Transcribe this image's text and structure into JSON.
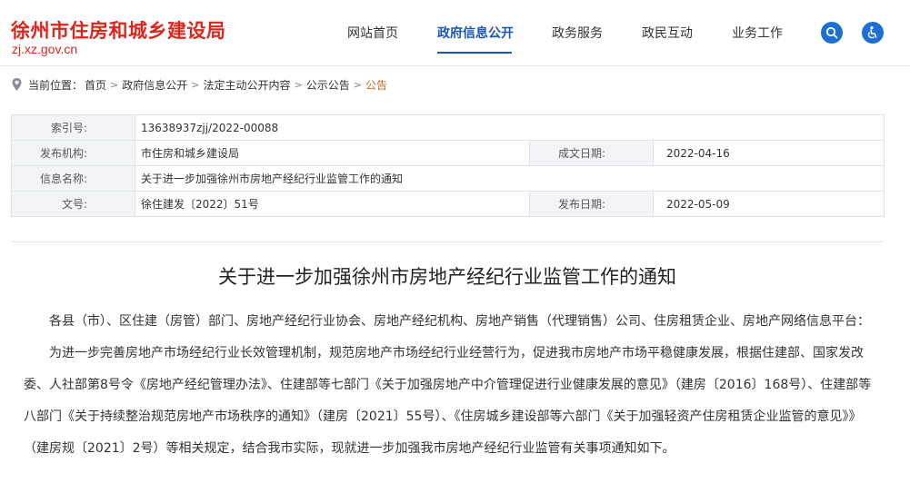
{
  "brand": {
    "title": "徐州市住房和城乡建设局",
    "domain": "zj.xz.gov.cn"
  },
  "nav": {
    "items": [
      {
        "label": "网站首页"
      },
      {
        "label": "政府信息公开"
      },
      {
        "label": "政务服务"
      },
      {
        "label": "政民互动"
      },
      {
        "label": "业务工作"
      }
    ],
    "active_index": 1
  },
  "colors": {
    "brand_red": "#d9271d",
    "nav_blue": "#1a55b8",
    "icon_blue": "#1e6fd2",
    "crumb_last": "#c06a2b"
  },
  "icons": {
    "search": "search-icon",
    "accessibility": "accessibility-icon",
    "location": "location-pin-icon"
  },
  "breadcrumb": {
    "prefix": "当前位置：",
    "items": [
      "首页",
      "政府信息公开",
      "法定主动公开内容",
      "公示公告",
      "公告"
    ],
    "separator": ">"
  },
  "meta": {
    "index_no_label": "索引号:",
    "index_no": "13638937zjj/2022-00088",
    "publisher_label": "发布机构:",
    "publisher": "市住房和城乡建设局",
    "created_label": "成文日期:",
    "created": "2022-04-16",
    "info_name_label": "信息名称:",
    "info_name": "关于进一步加强徐州市房地产经纪行业监管工作的通知",
    "doc_no_label": "文号:",
    "doc_no": "徐住建发〔2022〕51号",
    "published_label": "发布日期:",
    "published": "2022-05-09"
  },
  "article": {
    "title": "关于进一步加强徐州市房地产经纪行业监管工作的通知",
    "salutation": "各县（市）、区住建（房管）部门、房地产经纪行业协会、房地产经纪机构、房地产销售（代理销售）公司、住房租赁企业、房地产网络信息平台：",
    "paragraph1": "为进一步完善房地产市场经纪行业长效管理机制，规范房地产市场经纪行业经营行为，促进我市房地产市场平稳健康发展，根据住建部、国家发改委、人社部第8号令《房地产经纪管理办法》、住建部等七部门《关于加强房地产中介管理促进行业健康发展的意见》（建房〔2016〕168号）、住建部等八部门《关于持续整治规范房地产市场秩序的通知》（建房〔2021〕55号）、《住房城乡建设部等六部门《关于加强轻资产住房租赁企业监管的意见》》（建房规〔2021〕2号）等相关规定，结合我市实际，现就进一步加强我市房地产经纪行业监管有关事项通知如下。"
  }
}
